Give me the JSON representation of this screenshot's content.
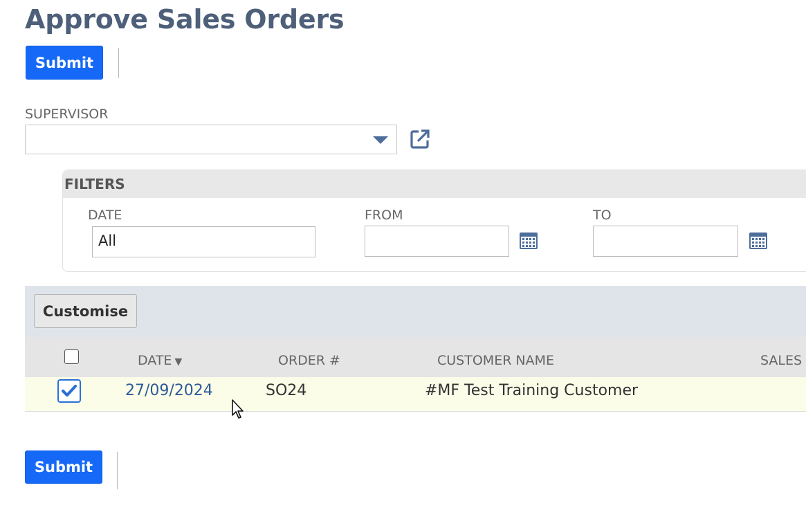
{
  "page": {
    "title": "Approve Sales Orders"
  },
  "actions": {
    "submit_label": "Submit"
  },
  "supervisor": {
    "label": "SUPERVISOR",
    "value": "",
    "dropdown_icon": "chevron-down-icon",
    "open_icon": "external-link-icon"
  },
  "filters": {
    "title": "FILTERS",
    "date": {
      "label": "DATE",
      "value": "All"
    },
    "from": {
      "label": "FROM",
      "value": "",
      "icon": "calendar-icon"
    },
    "to": {
      "label": "TO",
      "value": "",
      "icon": "calendar-icon"
    }
  },
  "list": {
    "customise_label": "Customise",
    "columns": {
      "date": "DATE",
      "date_sort": "▼",
      "order": "ORDER #",
      "customer": "CUSTOMER NAME",
      "sales": "SALES I"
    },
    "rows": [
      {
        "checked": true,
        "date": "27/09/2024",
        "order": "SO24",
        "customer": "#MF Test Training Customer"
      }
    ]
  },
  "colors": {
    "accent": "#1569f6",
    "title": "#4d5f79",
    "link": "#2e5b9a",
    "row_highlight": "#fcfde8"
  }
}
